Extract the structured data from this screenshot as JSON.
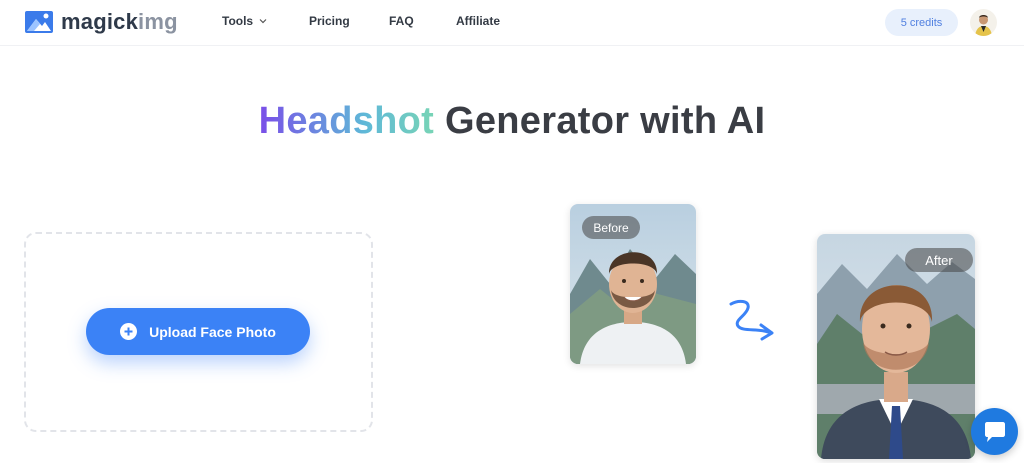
{
  "header": {
    "logo_text_a": "magick",
    "logo_text_b": "img",
    "nav": {
      "tools": "Tools",
      "pricing": "Pricing",
      "faq": "FAQ",
      "affiliate": "Affiliate"
    },
    "credits": "5 credits"
  },
  "hero": {
    "title_highlight": "Headshot",
    "title_rest": " Generator with AI"
  },
  "upload": {
    "button_label": "Upload Face Photo"
  },
  "example": {
    "before_label": "Before",
    "after_label": "After"
  },
  "colors": {
    "primary": "#3b82f6",
    "credits_bg": "#e8f0fc",
    "credits_text": "#4f7fe0",
    "chat": "#1f7ae0"
  },
  "icons": {
    "logo": "mountain-photo-icon",
    "tools_chevron": "chevron-down-icon",
    "upload": "plus-circle-icon",
    "arrow": "squiggle-arrow-icon",
    "chat": "chat-bubble-icon"
  }
}
